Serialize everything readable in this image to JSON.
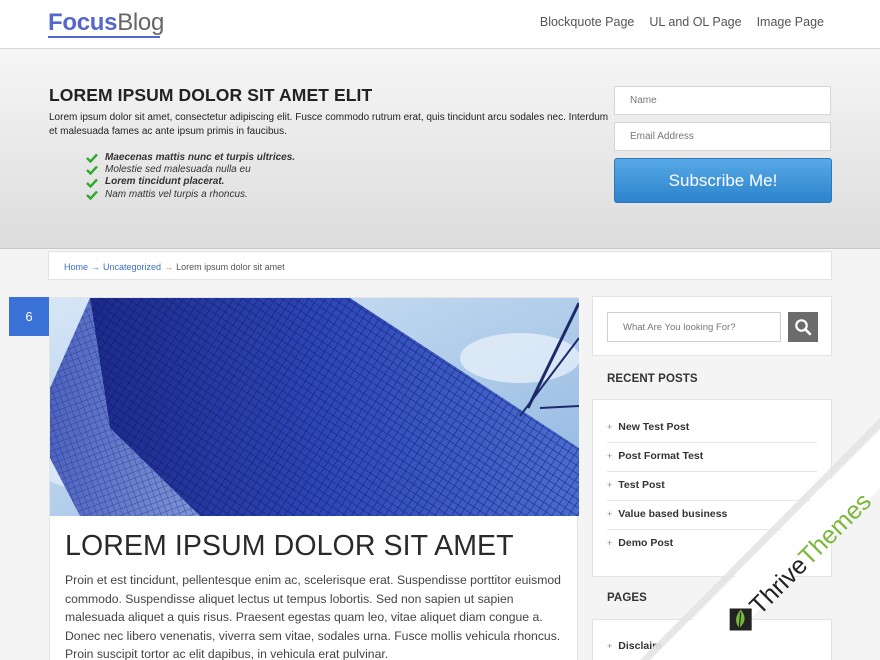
{
  "header": {
    "logo_part1": "Focus",
    "logo_part2": "Blog",
    "nav": [
      "Blockquote Page",
      "UL and OL Page",
      "Image Page"
    ]
  },
  "hero": {
    "title": "LOREM IPSUM DOLOR SIT AMET ELIT",
    "text": "Lorem ipsum dolor sit amet, consectetur adipiscing elit. Fusce commodo rutrum erat, quis tincidunt arcu sodales nec. Interdum et malesuada fames ac ante ipsum primis in faucibus.",
    "checklist": [
      "Maecenas mattis nunc et turpis ultrices.",
      "Molestie sed malesuada nulla eu",
      "Lorem tincidunt placerat.",
      "Nam mattis vel turpis a rhoncus."
    ],
    "name_placeholder": "Name",
    "email_placeholder": "Email Address",
    "subscribe_label": "Subscribe Me!"
  },
  "breadcrumb": {
    "home": "Home",
    "category": "Uncategorized",
    "current": "Lorem ipsum dolor sit amet"
  },
  "post": {
    "badge": "6",
    "title": "LOREM IPSUM DOLOR SIT AMET",
    "text": "Proin et est tincidunt, pellentesque enim ac, scelerisque erat. Suspendisse porttitor euismod commodo. Suspendisse aliquet lectus ut tempus lobortis. Sed non sapien ut sapien malesuada aliquet a quis risus. Praesent egestas quam leo, vitae aliquet diam congue a. Donec nec libero venenatis, viverra sem vitae, sodales urna. Fusce mollis vehicula rhoncus. Proin suscipit tortor ac elit dapibus, in vehicula erat pulvinar."
  },
  "sidebar": {
    "search_placeholder": "What Are You looking For?",
    "recent_heading": "RECENT POSTS",
    "recent_posts": [
      "New Test Post",
      "Post Format Test",
      "Test Post",
      "Value based business",
      "Demo Post"
    ],
    "pages_heading": "PAGES",
    "pages": [
      "Disclaim"
    ]
  },
  "banner": {
    "brand_part1": "Thrive",
    "brand_part2": "Themes"
  },
  "colors": {
    "accent": "#3a71d6",
    "button": "#2d84cc",
    "check": "#2ea82e",
    "banner_green": "#7ab83a"
  }
}
